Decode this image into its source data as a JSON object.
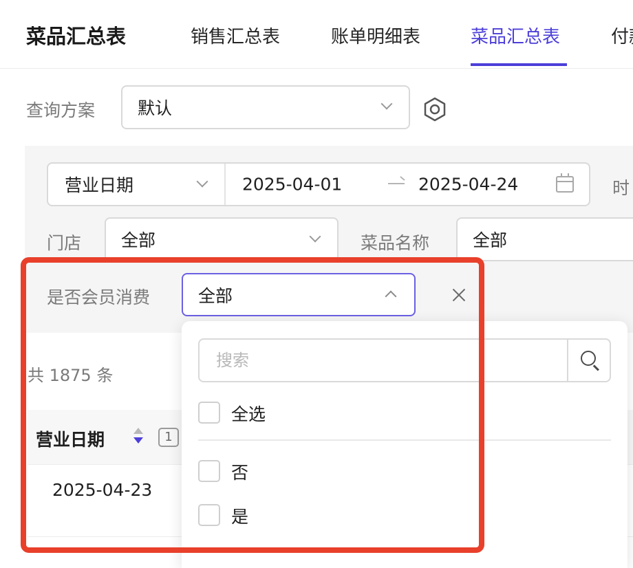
{
  "header": {
    "title": "菜品汇总表",
    "tabs": [
      {
        "label": "销售汇总表"
      },
      {
        "label": "账单明细表"
      },
      {
        "label": "菜品汇总表",
        "active": true
      },
      {
        "label": "付款"
      }
    ]
  },
  "query_plan": {
    "label": "查询方案",
    "value": "默认"
  },
  "filters": {
    "date_type": "营业日期",
    "date_start": "2025-04-01",
    "date_end": "2025-04-24",
    "truncated_label": "时",
    "store_label": "门店",
    "store_value": "全部",
    "dish_label": "菜品名称",
    "dish_value": "全部",
    "member_label": "是否会员消费",
    "member_value": "全部"
  },
  "dropdown": {
    "search_placeholder": "搜索",
    "select_all": "全选",
    "options": [
      "否",
      "是"
    ]
  },
  "table": {
    "total": "共 1875 条",
    "columns": [
      {
        "label": "营业日期",
        "sort_order": "1"
      }
    ],
    "rows": [
      [
        "2025-04-23"
      ]
    ]
  },
  "colors": {
    "accent": "#4c3fd9",
    "highlight": "#e8402b"
  }
}
